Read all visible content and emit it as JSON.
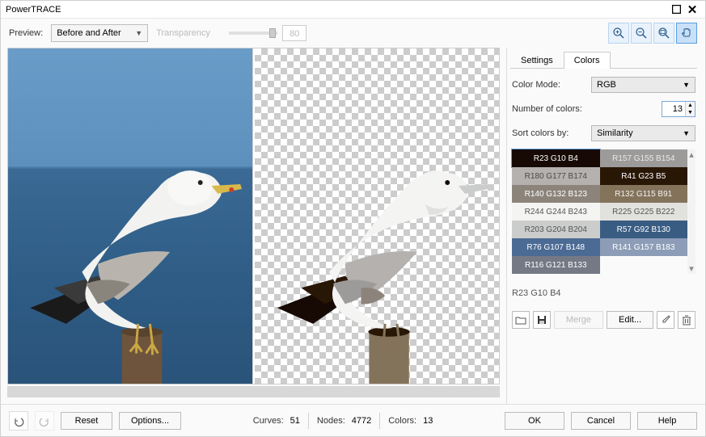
{
  "app": {
    "title": "PowerTRACE"
  },
  "toolbar": {
    "preview_label": "Preview:",
    "preview_mode": "Before and After",
    "transparency_label": "Transparency",
    "slider_label_dim": "",
    "num_value": "80"
  },
  "zoom": {
    "zoom_in": "zoom-in",
    "zoom_out": "zoom-out",
    "zoom_fit": "zoom-fit",
    "pan": "pan"
  },
  "tabs": {
    "settings": "Settings",
    "colors": "Colors"
  },
  "side": {
    "color_mode_label": "Color Mode:",
    "color_mode_value": "RGB",
    "num_colors_label": "Number of colors:",
    "num_colors_value": "13",
    "sort_label": "Sort colors by:",
    "sort_value": "Similarity",
    "swatches": [
      {
        "label": "R23 G10 B4",
        "bg": "#170a04",
        "fg": "#ffffff"
      },
      {
        "label": "R157 G155 B154",
        "bg": "#9d9b9a",
        "fg": "#e8e8e8"
      },
      {
        "label": "R180 G177 B174",
        "bg": "#b4b1ae",
        "fg": "#4a4a4a"
      },
      {
        "label": "R41 G23 B5",
        "bg": "#291705",
        "fg": "#ffffff"
      },
      {
        "label": "R140 G132 B123",
        "bg": "#8c847b",
        "fg": "#ffffff"
      },
      {
        "label": "R132 G115 B91",
        "bg": "#84735b",
        "fg": "#f2f2f2"
      },
      {
        "label": "R244 G244 B243",
        "bg": "#f4f4f3",
        "fg": "#555555"
      },
      {
        "label": "R225 G225 B222",
        "bg": "#e1e1de",
        "fg": "#555555"
      },
      {
        "label": "R203 G204 B204",
        "bg": "#cbcccc",
        "fg": "#555555"
      },
      {
        "label": "R57 G92 B130",
        "bg": "#395c82",
        "fg": "#ffffff"
      },
      {
        "label": "R76 G107 B148",
        "bg": "#4c6b94",
        "fg": "#ffffff"
      },
      {
        "label": "R141 G157 B183",
        "bg": "#8d9db7",
        "fg": "#ffffff"
      },
      {
        "label": "R116 G121 B133",
        "bg": "#747985",
        "fg": "#ffffff"
      }
    ],
    "selected_label": "R23 G10 B4",
    "merge_btn": "Merge",
    "edit_btn": "Edit..."
  },
  "footer": {
    "reset": "Reset",
    "options": "Options...",
    "curves_label": "Curves:",
    "curves_value": "51",
    "nodes_label": "Nodes:",
    "nodes_value": "4772",
    "colors_label": "Colors:",
    "colors_value": "13",
    "ok": "OK",
    "cancel": "Cancel",
    "help": "Help"
  }
}
